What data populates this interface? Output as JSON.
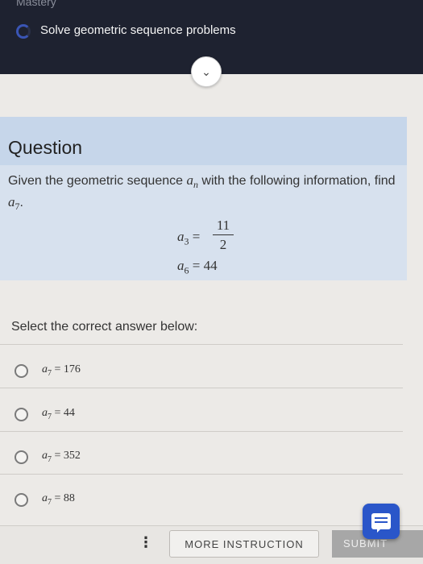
{
  "header": {
    "cut_text": "Mastery",
    "topic": "Solve geometric sequence problems",
    "expand_icon": "chevron-down-icon"
  },
  "question": {
    "title": "Question",
    "text_prefix": "Given the geometric sequence ",
    "sequence_symbol": "a",
    "sequence_subscript": "n",
    "text_middle": " with the following information, find ",
    "target_symbol": "a",
    "target_subscript": "7",
    "text_suffix": ".",
    "given": {
      "a3_lhs": "a",
      "a3_sub": "3",
      "a3_numerator": "11",
      "a3_denominator": "2",
      "a6_lhs": "a",
      "a6_sub": "6",
      "a6_value": "44"
    }
  },
  "prompt": "Select the correct answer below:",
  "options": [
    {
      "symbol": "a",
      "sub": "7",
      "value": "176"
    },
    {
      "symbol": "a",
      "sub": "7",
      "value": "44"
    },
    {
      "symbol": "a",
      "sub": "7",
      "value": "352"
    },
    {
      "symbol": "a",
      "sub": "7",
      "value": "88"
    }
  ],
  "footer": {
    "more_label": "MORE INSTRUCTION",
    "submit_label": "SUBMIT",
    "menu_icon": "kebab-menu-icon",
    "chat_icon": "chat-icon"
  },
  "colors": {
    "header_bg": "#1e2230",
    "card_bg": "#c6d6ea",
    "accent": "#2a56c9"
  }
}
